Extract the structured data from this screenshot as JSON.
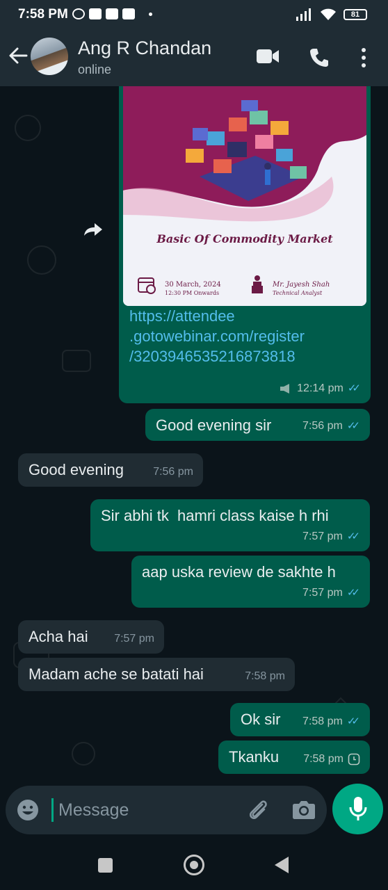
{
  "status_bar": {
    "time": "7:58 PM",
    "battery": "81"
  },
  "header": {
    "name": "Ang R Chandan",
    "status": "online"
  },
  "poster": {
    "title": "Basic Of Commodity Market",
    "date": "30 March, 2024",
    "time": "12:30 PM Onwards",
    "speaker": "Mr. Jayesh Shah",
    "speaker_role": "Technical Analyst"
  },
  "messages": [
    {
      "direction": "outgoing",
      "link_lines": [
        "https://attendee",
        ".gotowebinar.com/register",
        "/3203946535216873818"
      ],
      "time": "12:14 pm",
      "status": "read"
    },
    {
      "direction": "outgoing",
      "text": "Good evening sir",
      "time": "7:56 pm",
      "status": "read"
    },
    {
      "direction": "incoming",
      "text": "Good evening",
      "time": "7:56 pm"
    },
    {
      "direction": "outgoing",
      "text": "Sir abhi tk  hamri class kaise h rhi",
      "time": "7:57 pm",
      "status": "read"
    },
    {
      "direction": "outgoing",
      "text": "aap uska review de sakhte h",
      "time": "7:57 pm",
      "status": "read"
    },
    {
      "direction": "incoming",
      "text": "Acha hai",
      "time": "7:57 pm"
    },
    {
      "direction": "incoming",
      "text": "Madam ache se batati hai",
      "time": "7:58 pm"
    },
    {
      "direction": "outgoing",
      "text": "Ok sir",
      "time": "7:58 pm",
      "status": "read"
    },
    {
      "direction": "outgoing",
      "text": "Tkanku",
      "time": "7:58 pm",
      "status": "pending"
    }
  ],
  "composer": {
    "placeholder": "Message"
  },
  "colors": {
    "outgoing_bubble": "#005c4b",
    "incoming_bubble": "#202c33",
    "accent": "#00a884",
    "read_ticks": "#53bdeb"
  }
}
